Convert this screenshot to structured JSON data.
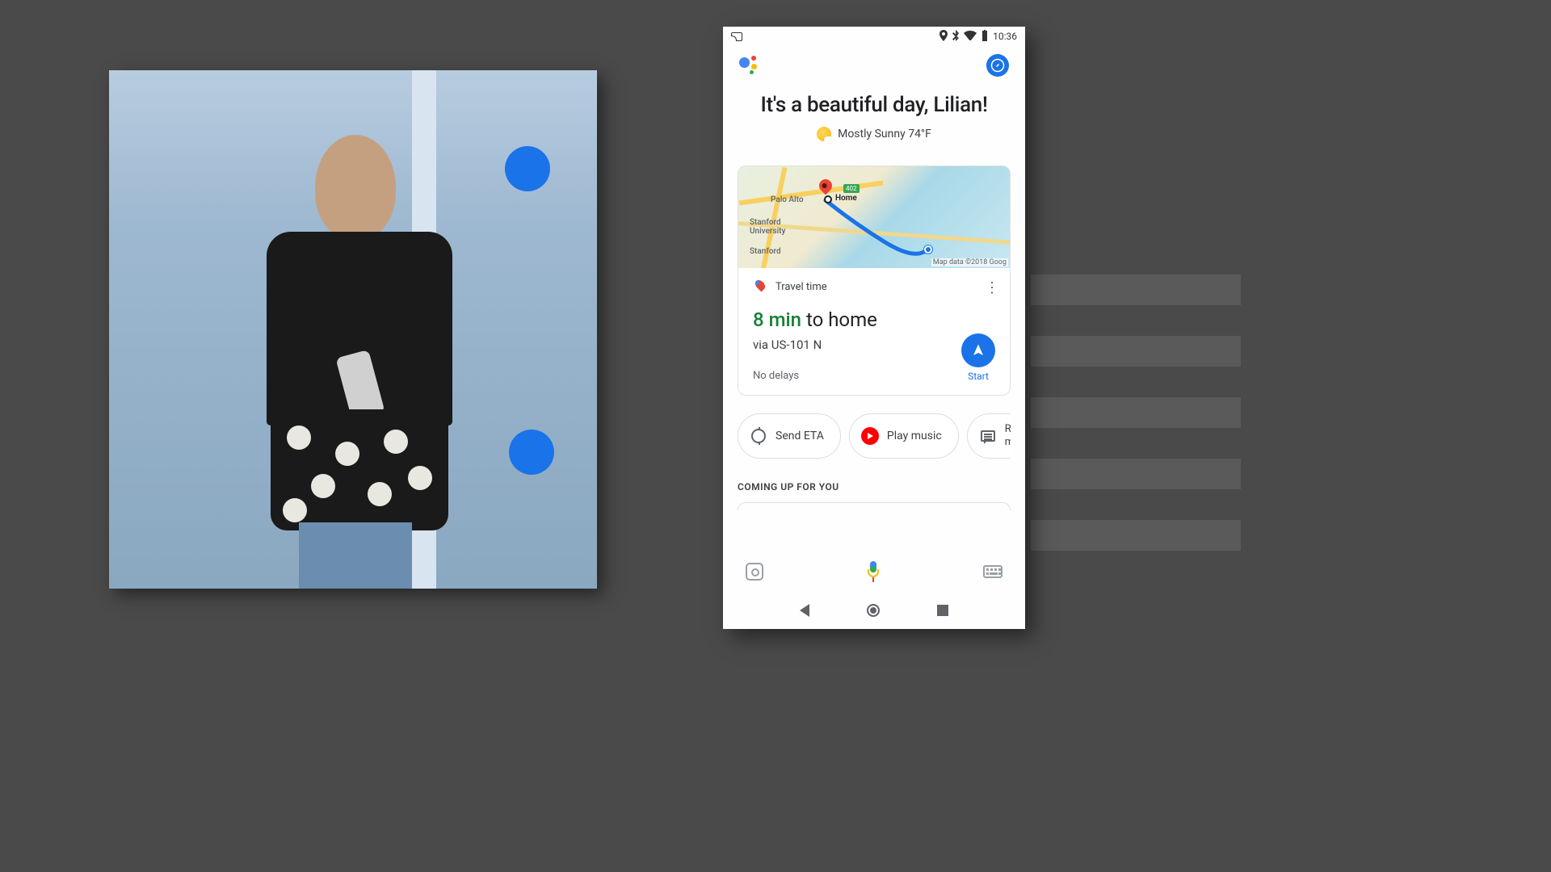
{
  "status_bar": {
    "time": "10:36"
  },
  "header": {
    "greeting": "It's a beautiful day, Lilian!",
    "weather": "Mostly Sunny 74°F"
  },
  "map": {
    "city_label": "Palo Alto",
    "home_label": "Home",
    "uni_label_1": "Stanford\nUniversity",
    "uni_label_2": "Stanford",
    "road_badge": "402",
    "attribution": "Map data ©2018 Goog"
  },
  "travel": {
    "card_title": "Travel time",
    "duration": "8 min",
    "destination": " to home",
    "via": "via US-101 N",
    "status": "No delays",
    "start_label": "Start"
  },
  "chips": {
    "send_eta": "Send ETA",
    "play_music": "Play music",
    "read_msg_l1": "Rea",
    "read_msg_l2": "mes"
  },
  "sections": {
    "coming_up": "COMING UP FOR YOU"
  }
}
